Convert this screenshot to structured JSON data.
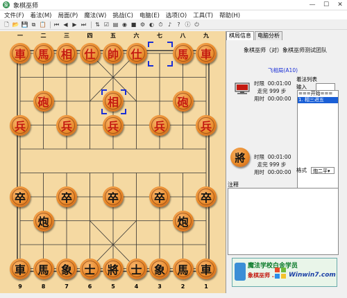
{
  "window": {
    "title": "象棋巫师",
    "minimize": "—",
    "maximize": "☐",
    "close": "✕"
  },
  "menu": [
    "文件(F)",
    "着法(M)",
    "局面(P)",
    "魔法(W)",
    "挑战(C)",
    "电脑(E)",
    "选项(O)",
    "工具(T)",
    "帮助(H)"
  ],
  "toolbar_icons": [
    "new-icon",
    "open-icon",
    "save-icon",
    "copy-icon",
    "paste-icon",
    "first-icon",
    "prev-icon",
    "next-icon",
    "last-icon",
    "flip-icon",
    "hint-icon",
    "book-icon",
    "engine-icon",
    "stop-icon",
    "rule-icon",
    "level-icon",
    "clock-icon",
    "sound-icon",
    "help-icon",
    "about-icon",
    "exit-icon"
  ],
  "board": {
    "top_files": [
      "一",
      "二",
      "三",
      "四",
      "五",
      "六",
      "七",
      "八",
      "九"
    ],
    "bottom_files": [
      "9",
      "8",
      "7",
      "6",
      "5",
      "4",
      "3",
      "2",
      "1"
    ],
    "pieces": [
      {
        "t": "車",
        "c": "red",
        "col": 0,
        "row": 0
      },
      {
        "t": "馬",
        "c": "red",
        "col": 1,
        "row": 0
      },
      {
        "t": "相",
        "c": "red",
        "col": 2,
        "row": 0
      },
      {
        "t": "仕",
        "c": "red",
        "col": 3,
        "row": 0
      },
      {
        "t": "帥",
        "c": "red",
        "col": 4,
        "row": 0
      },
      {
        "t": "仕",
        "c": "red",
        "col": 5,
        "row": 0
      },
      {
        "t": "馬",
        "c": "red",
        "col": 7,
        "row": 0
      },
      {
        "t": "車",
        "c": "red",
        "col": 8,
        "row": 0
      },
      {
        "t": "砲",
        "c": "red",
        "col": 1,
        "row": 2
      },
      {
        "t": "相",
        "c": "red",
        "col": 4,
        "row": 2
      },
      {
        "t": "砲",
        "c": "red",
        "col": 7,
        "row": 2
      },
      {
        "t": "兵",
        "c": "red",
        "col": 0,
        "row": 3
      },
      {
        "t": "兵",
        "c": "red",
        "col": 2,
        "row": 3
      },
      {
        "t": "兵",
        "c": "red",
        "col": 4,
        "row": 3
      },
      {
        "t": "兵",
        "c": "red",
        "col": 6,
        "row": 3
      },
      {
        "t": "兵",
        "c": "red",
        "col": 8,
        "row": 3
      },
      {
        "t": "卒",
        "c": "black",
        "col": 0,
        "row": 6
      },
      {
        "t": "卒",
        "c": "black",
        "col": 2,
        "row": 6
      },
      {
        "t": "卒",
        "c": "black",
        "col": 4,
        "row": 6
      },
      {
        "t": "卒",
        "c": "black",
        "col": 6,
        "row": 6
      },
      {
        "t": "卒",
        "c": "black",
        "col": 8,
        "row": 6
      },
      {
        "t": "炮",
        "c": "black",
        "col": 1,
        "row": 7
      },
      {
        "t": "炮",
        "c": "black",
        "col": 7,
        "row": 7
      },
      {
        "t": "車",
        "c": "black",
        "col": 0,
        "row": 9
      },
      {
        "t": "馬",
        "c": "black",
        "col": 1,
        "row": 9
      },
      {
        "t": "象",
        "c": "black",
        "col": 2,
        "row": 9
      },
      {
        "t": "士",
        "c": "black",
        "col": 3,
        "row": 9
      },
      {
        "t": "將",
        "c": "black",
        "col": 4,
        "row": 9
      },
      {
        "t": "士",
        "c": "black",
        "col": 5,
        "row": 9
      },
      {
        "t": "象",
        "c": "black",
        "col": 6,
        "row": 9
      },
      {
        "t": "馬",
        "c": "black",
        "col": 7,
        "row": 9
      },
      {
        "t": "車",
        "c": "black",
        "col": 8,
        "row": 9
      }
    ],
    "selected": [
      {
        "col": 6,
        "row": 0
      },
      {
        "col": 4,
        "row": 2
      }
    ]
  },
  "tabs": [
    "棋局信息",
    "电脑分析"
  ],
  "players": "象棋巫师（对）象棋巫师测试团队",
  "level": "飞相局(A10)",
  "red_clock": {
    "limit_label": "时限",
    "limit": "00:01:00",
    "moves_label": "走完",
    "moves": "999",
    "unit": "步",
    "used_label": "用时",
    "used": "00:00:00"
  },
  "black_clock": {
    "limit_label": "时限",
    "limit": "00:01:00",
    "moves_label": "走完",
    "moves": "999",
    "unit": "步",
    "used_label": "用时",
    "used": "00:00:00"
  },
  "movelist": {
    "label": "着法列表",
    "input_label": "输入",
    "items": [
      "===开始===",
      "1. 相三进五"
    ],
    "selected": 1
  },
  "format": {
    "label": "格式",
    "value": "炮二平▾"
  },
  "side_piece": "將",
  "notes_label": "注释",
  "ad": {
    "line1": "魔法学校白金学员",
    "line2": "象棋巫师 ..."
  },
  "watermark": "Winwin7.com"
}
